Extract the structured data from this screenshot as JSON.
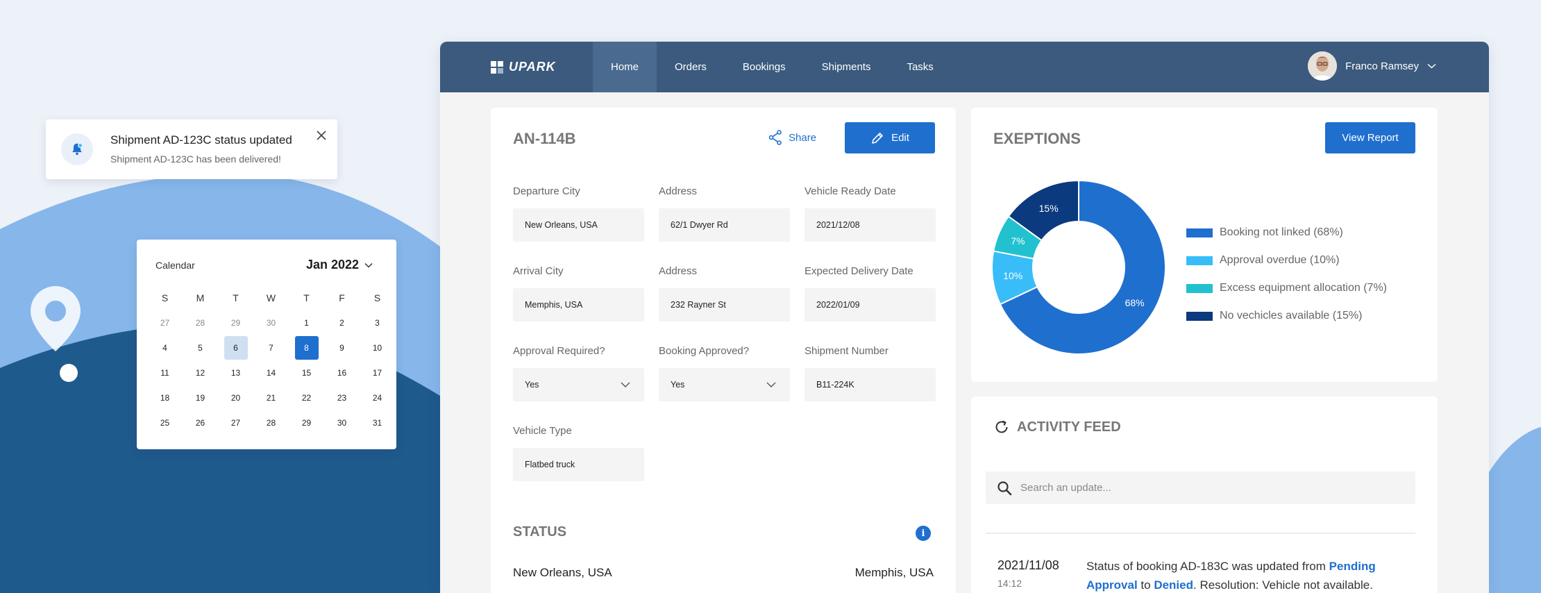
{
  "colors": {
    "brand": "#1f6fce",
    "topbar": "#3b5a7d",
    "series": [
      "#1f6fce",
      "#38bdf8",
      "#22c1cf",
      "#0b3a7e"
    ]
  },
  "notification": {
    "icon": "bell-icon",
    "title": "Shipment AD-123C status updated",
    "message": "Shipment AD-123C has been delivered!"
  },
  "calendar": {
    "label": "Calendar",
    "month": "Jan 2022",
    "weekdays": [
      "S",
      "M",
      "T",
      "W",
      "T",
      "F",
      "S"
    ],
    "weeks": [
      [
        "27",
        "28",
        "29",
        "30",
        "1",
        "2",
        "3"
      ],
      [
        "4",
        "5",
        "6",
        "7",
        "8",
        "9",
        "10"
      ],
      [
        "11",
        "12",
        "13",
        "14",
        "15",
        "16",
        "17"
      ],
      [
        "18",
        "19",
        "20",
        "21",
        "22",
        "23",
        "24"
      ],
      [
        "25",
        "26",
        "27",
        "28",
        "29",
        "30",
        "31"
      ]
    ],
    "selected_day": "6",
    "today_day": "8"
  },
  "topbar": {
    "logo": "UPARK",
    "nav": [
      "Home",
      "Orders",
      "Bookings",
      "Shipments",
      "Tasks"
    ],
    "active_nav": "Home",
    "user_name": "Franco Ramsey"
  },
  "shipment": {
    "id": "AN-114B",
    "share_label": "Share",
    "edit_label": "Edit",
    "fields": {
      "departure_city": {
        "label": "Departure City",
        "value": "New Orleans, USA"
      },
      "departure_address": {
        "label": "Address",
        "value": "62/1 Dwyer Rd"
      },
      "vehicle_ready_date": {
        "label": "Vehicle Ready Date",
        "value": "2021/12/08"
      },
      "arrival_city": {
        "label": "Arrival City",
        "value": "Memphis, USA"
      },
      "arrival_address": {
        "label": "Address",
        "value": "232 Rayner St"
      },
      "expected_delivery_date": {
        "label": "Expected Delivery Date",
        "value": "2022/01/09"
      },
      "approval_required": {
        "label": "Approval Required?",
        "value": "Yes"
      },
      "booking_approved": {
        "label": "Booking Approved?",
        "value": "Yes"
      },
      "shipment_number": {
        "label": "Shipment Number",
        "value": "B11-224K"
      },
      "vehicle_type": {
        "label": "Vehicle Type",
        "value": "Flatbed truck"
      }
    },
    "status_title": "STATUS",
    "route_from": "New Orleans, USA",
    "route_to": "Memphis, USA"
  },
  "exceptions": {
    "title": "EXEPTIONS",
    "view_report_label": "View Report"
  },
  "chart_data": {
    "type": "pie",
    "title": "",
    "categories": [
      "Booking not linked (68%)",
      "Approval overdue (10%)",
      "Excess equipment allocation (7%)",
      "No vechicles available (15%)"
    ],
    "values": [
      68,
      10,
      7,
      15
    ],
    "slice_labels": [
      "68%",
      "10%",
      "7%",
      "15%"
    ],
    "legend_position": "right"
  },
  "activity": {
    "title": "ACTIVITY FEED",
    "search_placeholder": "Search an update...",
    "item": {
      "date": "2021/11/08",
      "time": "14:12",
      "text_1": "Status of booking AD-183C was updated from ",
      "link_1": "Pending Approval",
      "text_2": " to ",
      "link_2": "Denied",
      "text_3": ". Resolution: Vehicle not available."
    }
  }
}
